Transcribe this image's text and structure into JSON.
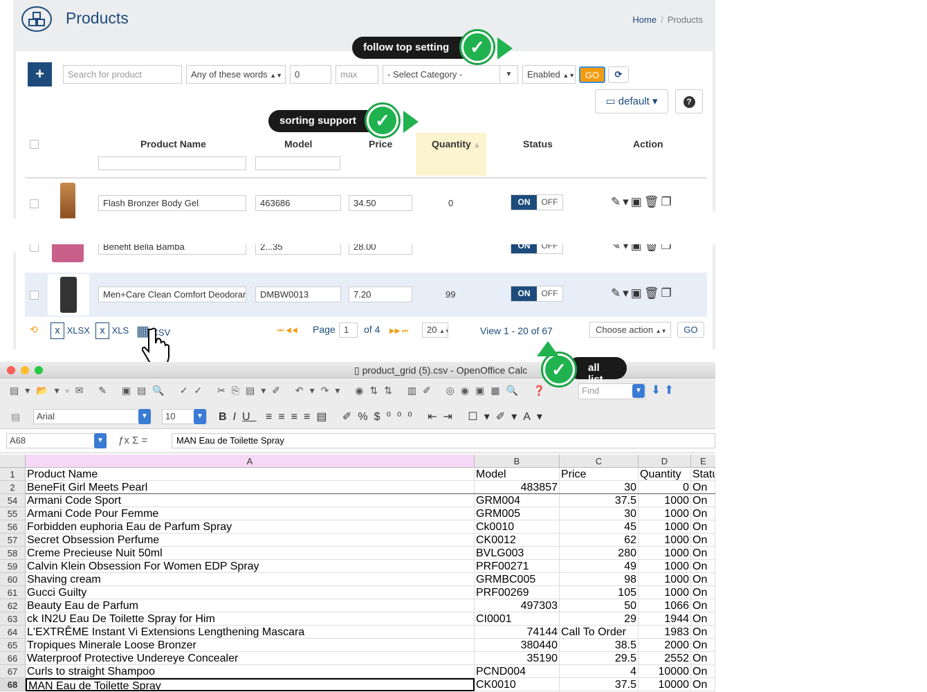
{
  "header": {
    "title": "Products",
    "breadcrumb": [
      "Home",
      "Products"
    ]
  },
  "filters": {
    "search_placeholder": "Search for product",
    "match_mode": "Any of these words",
    "min_value": "0",
    "max_placeholder": "max",
    "category": "- Select Category -",
    "status": "Enabled",
    "go_label": "GO",
    "view_label": "default"
  },
  "callouts": {
    "top": "follow top setting",
    "sort": "sorting support",
    "all": "all list"
  },
  "table": {
    "columns": [
      "Product Name",
      "Model",
      "Price",
      "Quantity",
      "Status",
      "Action"
    ],
    "rows": [
      {
        "name": "Flash Bronzer Body Gel",
        "model": "463686",
        "price": "34.50",
        "qty": "0",
        "on": "ON",
        "off": "OFF"
      },
      {
        "name": "Benefit Bella Bamba",
        "model": "2...35",
        "price": "28.00",
        "qty": "",
        "on": "ON",
        "off": "OFF"
      },
      {
        "name": "Men+Care Clean Comfort Deodorant",
        "model": "DMBW0013",
        "price": "7.20",
        "qty": "99",
        "on": "ON",
        "off": "OFF"
      }
    ]
  },
  "footer": {
    "exports": [
      "XLSX",
      "XLS",
      "CSV"
    ],
    "page_label": "Page",
    "page": "1",
    "of_label": "of 4",
    "per_page": "20",
    "view_info": "View 1 - 20 of 67",
    "choose_action": "Choose action",
    "go_label": "GO"
  },
  "calc": {
    "window_title": "product_grid (5).csv - OpenOffice Calc",
    "find_placeholder": "Find",
    "font": "Arial",
    "font_size": "10",
    "cell_ref": "A68",
    "formula": "MAN Eau de Toilette Spray",
    "col_headers": [
      "A",
      "B",
      "C",
      "D",
      "E"
    ],
    "rows": [
      {
        "n": "1",
        "a": "Product Name",
        "b": "Model",
        "c": "Price",
        "d": "Quantity",
        "e": "Statu"
      },
      {
        "n": "2",
        "a": "BeneFit Girl Meets Pearl",
        "b": "483857",
        "c": "30",
        "d": "0",
        "e": "On"
      },
      {
        "n": "54",
        "a": "Armani Code Sport",
        "b": "GRM004",
        "c": "37.5",
        "d": "1000",
        "e": "On"
      },
      {
        "n": "55",
        "a": "Armani Code Pour Femme",
        "b": "GRM005",
        "c": "30",
        "d": "1000",
        "e": "On"
      },
      {
        "n": "56",
        "a": "Forbidden euphoria Eau de Parfum Spray",
        "b": "Ck0010",
        "c": "45",
        "d": "1000",
        "e": "On"
      },
      {
        "n": "57",
        "a": "Secret Obsession Perfume",
        "b": "CK0012",
        "c": "62",
        "d": "1000",
        "e": "On"
      },
      {
        "n": "58",
        "a": "Creme Precieuse Nuit 50ml",
        "b": "BVLG003",
        "c": "280",
        "d": "1000",
        "e": "On"
      },
      {
        "n": "59",
        "a": "Calvin Klein Obsession For Women EDP Spray",
        "b": "PRF00271",
        "c": "49",
        "d": "1000",
        "e": "On"
      },
      {
        "n": "60",
        "a": "Shaving cream",
        "b": "GRMBC005",
        "c": "98",
        "d": "1000",
        "e": "On"
      },
      {
        "n": "61",
        "a": "Gucci Guilty",
        "b": "PRF00269",
        "c": "105",
        "d": "1000",
        "e": "On"
      },
      {
        "n": "62",
        "a": "Beauty Eau de Parfum",
        "b": "497303",
        "c": "50",
        "d": "1066",
        "e": "On"
      },
      {
        "n": "63",
        "a": "ck IN2U Eau De Toilette Spray for Him",
        "b": "CI0001",
        "c": "29",
        "d": "1944",
        "e": "On"
      },
      {
        "n": "64",
        "a": "L'EXTRÊME Instant Vi Extensions Lengthening Mascara",
        "b": "74144",
        "c": "Call To Order",
        "d": "1983",
        "e": "On"
      },
      {
        "n": "65",
        "a": "Tropiques Minerale Loose Bronzer",
        "b": "380440",
        "c": "38.5",
        "d": "2000",
        "e": "On"
      },
      {
        "n": "66",
        "a": "Waterproof Protective Undereye Concealer",
        "b": "35190",
        "c": "29.5",
        "d": "2552",
        "e": "On"
      },
      {
        "n": "67",
        "a": "Curls to straight Shampoo",
        "b": "PCND004",
        "c": "4",
        "d": "10000",
        "e": "On"
      },
      {
        "n": "68",
        "a": "MAN Eau de Toilette Spray",
        "b": "CK0010",
        "c": "37.5",
        "d": "10000",
        "e": "On"
      }
    ]
  }
}
